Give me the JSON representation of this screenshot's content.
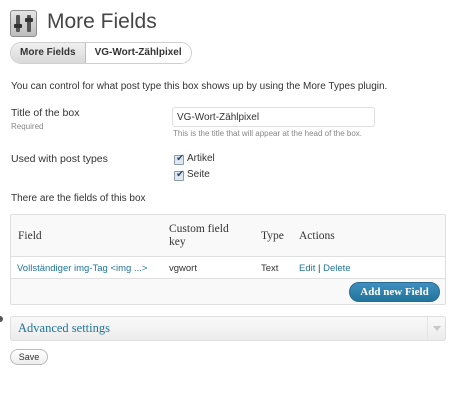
{
  "header": {
    "title": "More Fields",
    "icon": "more-fields-icon"
  },
  "breadcrumb": {
    "items": [
      "More Fields",
      "VG-Wort-Zählpixel"
    ]
  },
  "description": "You can control for what post type this box shows up by using the More Types plugin.",
  "form": {
    "title_label": "Title of the box",
    "title_required": "Required",
    "title_value": "VG-Wort-Zählpixel",
    "title_hint": "This is the title that will appear at the head of the box.",
    "post_types_label": "Used with post types",
    "post_types": [
      {
        "label": "Artikel",
        "checked": true
      },
      {
        "label": "Seite",
        "checked": true
      }
    ]
  },
  "fields_section": {
    "heading": "There are the fields of this box",
    "columns": {
      "field": "Field",
      "custom_key_line1": "Custom field",
      "custom_key_line2": "key",
      "type": "Type",
      "actions": "Actions"
    },
    "rows": [
      {
        "field": "Vollständiger img-Tag <img ...>",
        "key": "vgwort",
        "type": "Text",
        "edit": "Edit",
        "separator": "|",
        "delete": "Delete"
      }
    ],
    "add_button": "Add new Field"
  },
  "advanced": {
    "title": "Advanced settings"
  },
  "save_button": "Save",
  "colors": {
    "link": "#21759b",
    "primary_button": "#21759b",
    "text": "#333333"
  }
}
